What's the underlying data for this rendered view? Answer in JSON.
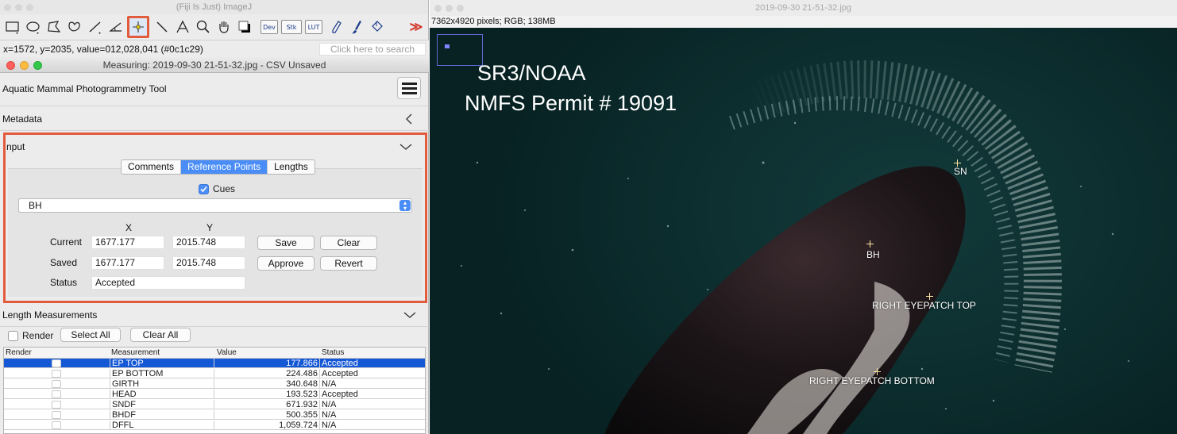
{
  "imagej": {
    "window_title": "(Fiji Is Just) ImageJ",
    "tools": [
      {
        "name": "rectangle-tool-icon"
      },
      {
        "name": "oval-tool-icon"
      },
      {
        "name": "polygon-tool-icon"
      },
      {
        "name": "freehand-tool-icon"
      },
      {
        "name": "line-tool-icon"
      },
      {
        "name": "angle-tool-icon"
      },
      {
        "name": "point-tool-icon",
        "selected": true
      },
      {
        "name": "wand-tool-icon"
      },
      {
        "name": "text-tool-icon"
      },
      {
        "name": "zoom-tool-icon"
      },
      {
        "name": "hand-tool-icon"
      },
      {
        "name": "color-picker-icon"
      }
    ],
    "dev_label": "Dev",
    "stk_label": "Stk",
    "lut_label": "LUT",
    "more_label": "≫",
    "status_text": "x=1572, y=2035, value=012,028,041 (#0c1c29)",
    "search_placeholder": "Click here to search",
    "accent_color": "#e25b3d"
  },
  "measuring": {
    "window_title": "Measuring: 2019-09-30 21-51-32.jpg  - CSV Unsaved",
    "app_title": "Aquatic Mammal Photogrammetry Tool",
    "metadata_label": "Metadata",
    "input_label": "nput",
    "tabs": [
      {
        "label": "Comments",
        "active": false
      },
      {
        "label": "Reference Points",
        "active": true
      },
      {
        "label": "Lengths",
        "active": false
      }
    ],
    "cues_label": "Cues",
    "cues_checked": true,
    "dropdown_value": "BH",
    "col_x": "X",
    "col_y": "Y",
    "current_label": "Current",
    "current_x": "1677.177",
    "current_y": "2015.748",
    "saved_label": "Saved",
    "saved_x": "1677.177",
    "saved_y": "2015.748",
    "status_label": "Status",
    "status_value": "Accepted",
    "save_label": "Save",
    "clear_label": "Clear",
    "approve_label": "Approve",
    "revert_label": "Revert",
    "length_label": "Length Measurements",
    "render_label": "Render",
    "select_all_label": "Select All",
    "clear_all_label": "Clear All",
    "table_headers": [
      "Render",
      "Measurement",
      "Value",
      "Status"
    ],
    "rows": [
      {
        "name": "EP TOP",
        "value": "177.866",
        "status": "Accepted",
        "selected": true
      },
      {
        "name": "EP BOTTOM",
        "value": "224.486",
        "status": "Accepted"
      },
      {
        "name": "GIRTH",
        "value": "340.648",
        "status": "N/A"
      },
      {
        "name": "HEAD",
        "value": "193.523",
        "status": "Accepted"
      },
      {
        "name": "SNDF",
        "value": "671.932",
        "status": "N/A"
      },
      {
        "name": "BHDF",
        "value": "500.355",
        "status": "N/A"
      },
      {
        "name": "DFFL",
        "value": "1,059.724",
        "status": "N/A"
      }
    ]
  },
  "image": {
    "window_title": "2019-09-30 21-51-32.jpg",
    "info": "7362x4920 pixels; RGB; 138MB",
    "overlay_line1": "SR3/NOAA",
    "overlay_line2": "NMFS Permit # 19091",
    "points": [
      {
        "label": "SN"
      },
      {
        "label": "BH"
      },
      {
        "label": "RIGHT EYEPATCH TOP"
      },
      {
        "label": "RIGHT EYEPATCH BOTTOM"
      }
    ]
  }
}
